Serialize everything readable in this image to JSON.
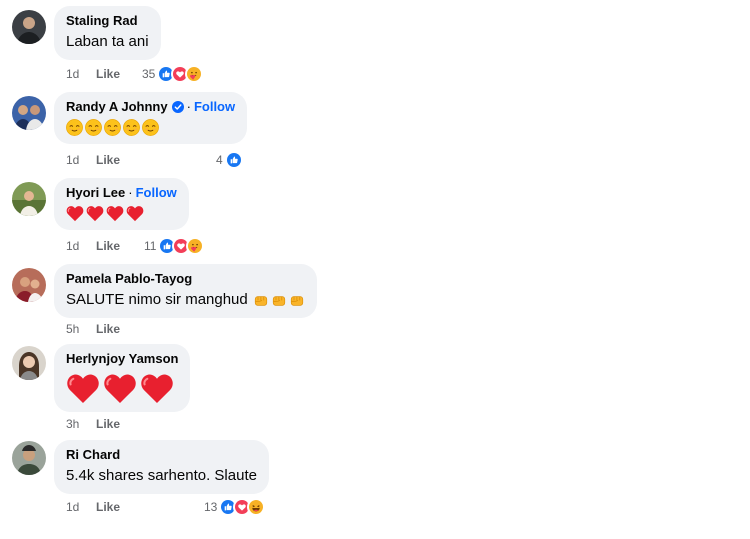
{
  "comments": [
    {
      "name": "Staling Rad",
      "text": "Laban ta ani",
      "time": "1d",
      "like": "Like",
      "reaction_count": "35",
      "reactions": [
        "like-icon",
        "love-icon",
        "care-icon"
      ]
    },
    {
      "name": "Randy A Johnny",
      "verified": true,
      "follow": "Follow",
      "text": "",
      "emojis": [
        "relieved-face-emoji",
        "relieved-face-emoji",
        "relieved-face-emoji",
        "relieved-face-emoji",
        "relieved-face-emoji"
      ],
      "time": "1d",
      "like": "Like",
      "reaction_count": "4",
      "reactions": [
        "like-icon"
      ]
    },
    {
      "name": "Hyori Lee",
      "follow": "Follow",
      "text": "",
      "emojis": [
        "red-heart-emoji",
        "red-heart-emoji",
        "red-heart-emoji",
        "red-heart-emoji"
      ],
      "time": "1d",
      "like": "Like",
      "reaction_count": "11",
      "reactions": [
        "like-icon",
        "love-icon",
        "care-icon"
      ]
    },
    {
      "name": "Pamela Pablo-Tayog",
      "text": "SALUTE nimo sir manghud",
      "emojis": [
        "fist-emoji",
        "fist-emoji",
        "fist-emoji"
      ],
      "time": "5h",
      "like": "Like"
    },
    {
      "name": "Herlynjoy Yamson",
      "text": "",
      "emojis": [
        "red-heart-emoji",
        "red-heart-emoji",
        "red-heart-emoji"
      ],
      "time": "3h",
      "like": "Like"
    },
    {
      "name": "Ri Chard",
      "text": "5.4k shares sarhento. Slaute",
      "time": "1d",
      "like": "Like",
      "reaction_count": "13",
      "reactions": [
        "like-icon",
        "love-icon",
        "haha-icon"
      ]
    }
  ],
  "separator": "·",
  "colors": {
    "bubble": "#f0f2f5",
    "follow": "#0866ff",
    "meta": "#65676b",
    "like_blue": "#1877f2",
    "love_red": "#f33e58",
    "emoji_yellow": "#f7b125"
  }
}
